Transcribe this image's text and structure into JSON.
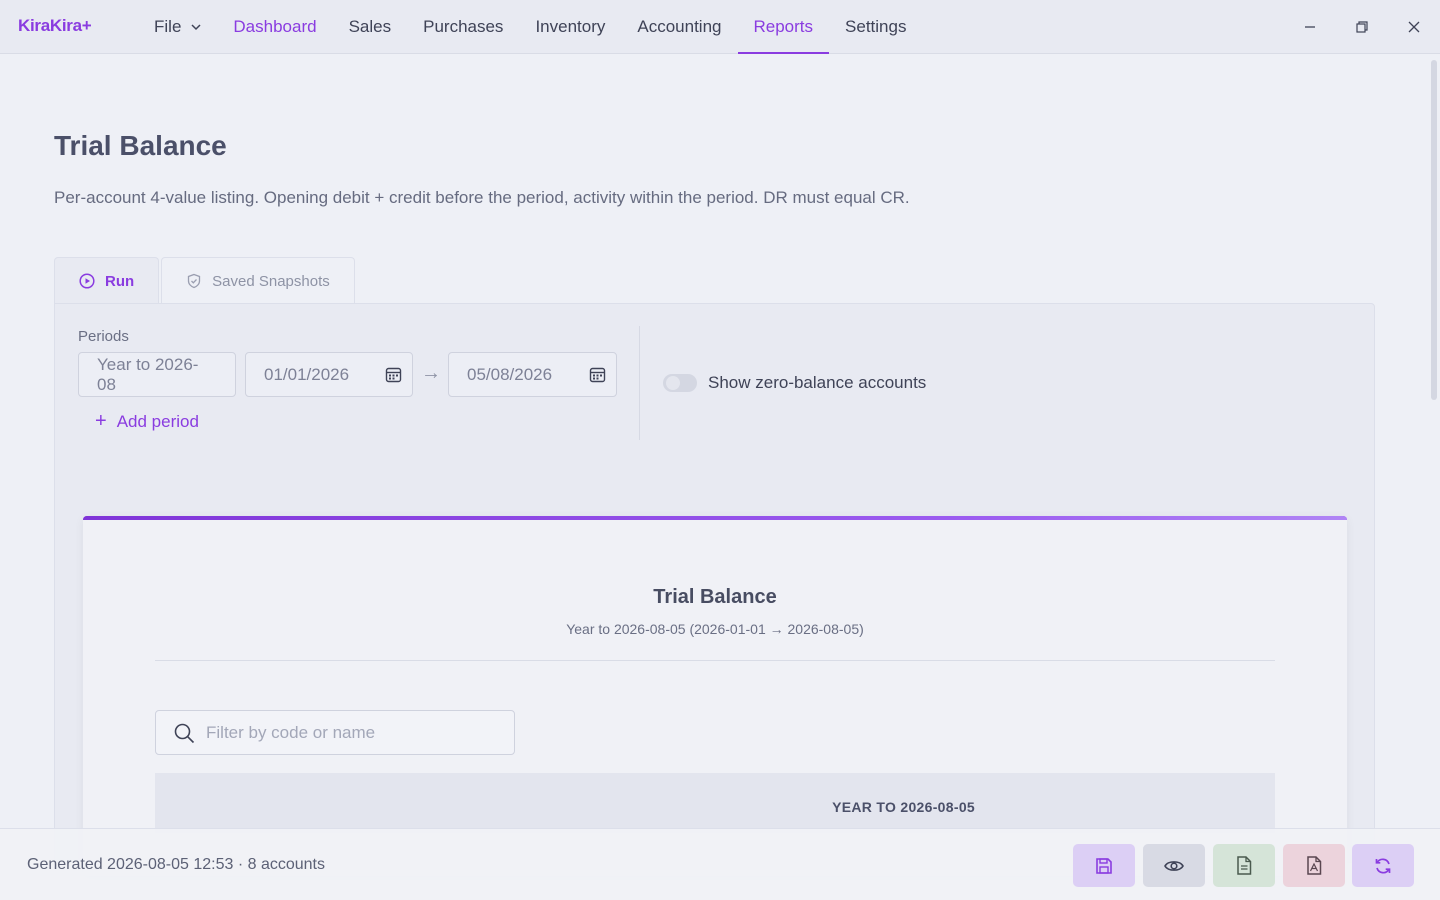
{
  "app": {
    "name": "KiraKira+"
  },
  "menu": {
    "file": "File",
    "items": [
      "Dashboard",
      "Sales",
      "Purchases",
      "Inventory",
      "Accounting",
      "Reports",
      "Settings"
    ],
    "active": "Reports"
  },
  "page": {
    "title": "Trial Balance",
    "description": "Per-account 4-value listing. Opening debit + credit before the period, activity within the period. DR must equal CR."
  },
  "tabs": {
    "run": "Run",
    "snapshots": "Saved Snapshots"
  },
  "periods": {
    "label": "Periods",
    "preset": "Year to 2026-08",
    "start_date": "01/01/2026",
    "arrow": "→",
    "end_date": "05/08/2026",
    "add_label": "Add period"
  },
  "options": {
    "zero_balance_label": "Show zero-balance accounts",
    "zero_balance_enabled": false
  },
  "report": {
    "title": "Trial Balance",
    "subtitle": "Year to 2026-08-05 (2026-01-01 → 2026-08-05)",
    "filter_placeholder": "Filter by code or name",
    "column_group": "YEAR TO 2026-08-05"
  },
  "footer": {
    "status": "Generated 2026-08-05 12:53 · 8 accounts"
  },
  "colors": {
    "accent": "#8a3ce0",
    "save_bg": "#dccff5",
    "preview_bg": "#d8dae4",
    "doc_bg": "#d5e4d8",
    "pdf_bg": "#ecd3dc",
    "refresh_bg": "#dccff5"
  }
}
